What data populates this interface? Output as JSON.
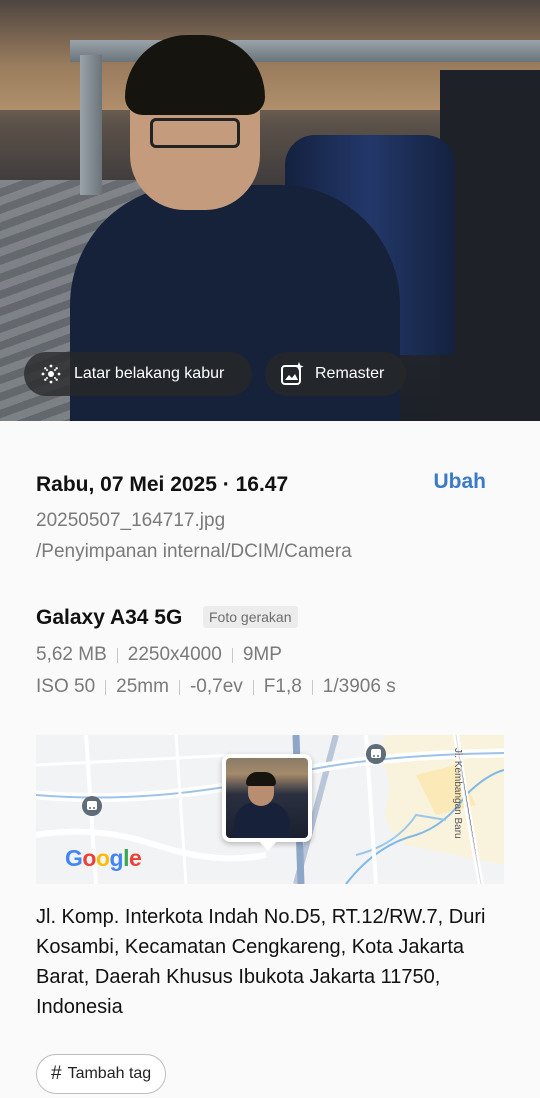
{
  "photo_actions": {
    "blur_label": "Latar belakang kabur",
    "remaster_label": "Remaster"
  },
  "details": {
    "datetime": "Rabu, 07 Mei 2025 · 16.47",
    "edit_label": "Ubah",
    "filename": "20250507_164717.jpg",
    "path": "/Penyimpanan internal/DCIM/Camera",
    "device": "Galaxy A34 5G",
    "badge": "Foto gerakan",
    "size": "5,62 MB",
    "resolution": "2250x4000",
    "megapixels": "9MP",
    "iso": "ISO 50",
    "focal": "25mm",
    "ev": "-0,7ev",
    "aperture": "F1,8",
    "shutter": "1/3906 s"
  },
  "map": {
    "street_label": "Jl. Kembangan Baru",
    "provider": "Google",
    "colors": {
      "g1": "#4285F4",
      "g2": "#EA4335",
      "g3": "#FBBC05",
      "g4": "#34A853"
    }
  },
  "address": "Jl. Komp. Interkota Indah No.D5, RT.12/RW.7, Duri Kosambi, Kecamatan Cengkareng, Kota Jakarta Barat, Daerah Khusus Ibukota Jakarta 11750, Indonesia",
  "tags": {
    "add_label": "Tambah tag"
  },
  "colors": {
    "accent": "#3a7bc8",
    "muted": "#7a7a7a"
  }
}
